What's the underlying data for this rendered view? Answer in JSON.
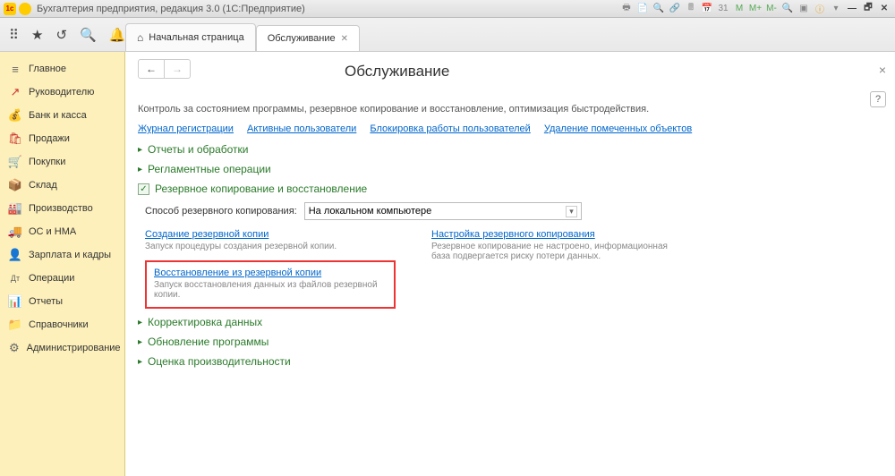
{
  "titlebar": {
    "title": "Бухгалтерия предприятия, редакция 3.0  (1С:Предприятие)",
    "zoom_m": "M",
    "zoom_mp": "M+",
    "zoom_mm": "M-"
  },
  "tabs": {
    "start": "Начальная страница",
    "service": "Обслуживание"
  },
  "sidebar": {
    "items": [
      {
        "label": "Главное",
        "icon": "≡",
        "cls": "gray"
      },
      {
        "label": "Руководителю",
        "icon": "↗",
        "cls": "red"
      },
      {
        "label": "Банк и касса",
        "icon": "💰",
        "cls": "green"
      },
      {
        "label": "Продажи",
        "icon": "🛍",
        "cls": "red"
      },
      {
        "label": "Покупки",
        "icon": "🛒",
        "cls": "blue"
      },
      {
        "label": "Склад",
        "icon": "📦",
        "cls": "gray"
      },
      {
        "label": "Производство",
        "icon": "🏭",
        "cls": "gray"
      },
      {
        "label": "ОС и НМА",
        "icon": "🚚",
        "cls": "gray"
      },
      {
        "label": "Зарплата и кадры",
        "icon": "👤",
        "cls": "gray"
      },
      {
        "label": "Операции",
        "icon": "Дт",
        "cls": "gray"
      },
      {
        "label": "Отчеты",
        "icon": "📊",
        "cls": "blue"
      },
      {
        "label": "Справочники",
        "icon": "📁",
        "cls": "gray"
      },
      {
        "label": "Администрирование",
        "icon": "⚙",
        "cls": "gray"
      }
    ]
  },
  "page": {
    "title": "Обслуживание",
    "description": "Контроль за состоянием программы, резервное копирование и восстановление, оптимизация быстродействия.",
    "help": "?",
    "links": {
      "log": "Журнал регистрации",
      "users": "Активные пользователи",
      "lock": "Блокировка работы пользователей",
      "delete": "Удаление помеченных объектов"
    },
    "sections": {
      "reports": "Отчеты и обработки",
      "regops": "Регламентные операции",
      "backup": "Резервное копирование и восстановление",
      "correct": "Корректировка данных",
      "update": "Обновление программы",
      "perf": "Оценка производительности"
    },
    "backup": {
      "method_label": "Способ резервного копирования:",
      "method_value": "На локальном компьютере",
      "left": {
        "create_link": "Создание резервной копии",
        "create_sub": "Запуск процедуры создания резервной копии.",
        "restore_link": "Восстановление из резервной копии",
        "restore_sub": "Запуск восстановления данных из файлов резервной копии."
      },
      "right": {
        "config_link": "Настройка резервного копирования",
        "config_sub": "Резервное копирование не настроено, информационная база подвергается риску потери данных."
      }
    }
  }
}
